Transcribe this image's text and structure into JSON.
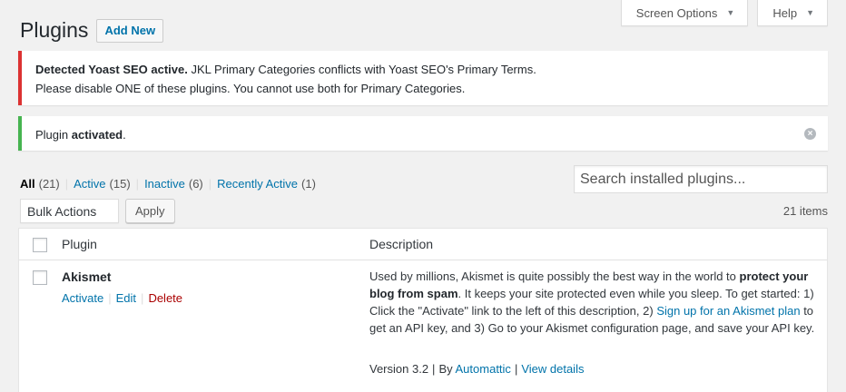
{
  "screen_meta": {
    "screen_options_label": "Screen Options",
    "help_label": "Help",
    "caret_glyph": "▼"
  },
  "header": {
    "title": "Plugins",
    "add_new_label": "Add New"
  },
  "notices": {
    "error": {
      "strong": "Detected Yoast SEO active.",
      "text1": " JKL Primary Categories conflicts with Yoast SEO's Primary Terms.",
      "text2": "Please disable ONE of these plugins. You cannot use both for Primary Categories.",
      "accent_color": "#dc3232"
    },
    "success": {
      "prefix": "Plugin ",
      "strong": "activated",
      "suffix": ".",
      "accent_color": "#46b450",
      "dismiss_glyph": "×"
    }
  },
  "filters": {
    "all": {
      "label": "All",
      "count": "(21)"
    },
    "active": {
      "label": "Active",
      "count": "(15)"
    },
    "inactive": {
      "label": "Inactive",
      "count": "(6)"
    },
    "recently_active": {
      "label": "Recently Active",
      "count": "(1)"
    },
    "separator": "|"
  },
  "search": {
    "placeholder": "Search installed plugins..."
  },
  "bulk": {
    "selected": "Bulk Actions",
    "apply_label": "Apply",
    "items_count": "21 items"
  },
  "table": {
    "headers": {
      "plugin": "Plugin",
      "description": "Description"
    },
    "rows": [
      {
        "name": "Akismet",
        "actions": {
          "activate": "Activate",
          "edit": "Edit",
          "delete": "Delete",
          "separator": "|"
        },
        "description": {
          "p1": "Used by millions, Akismet is quite possibly the best way in the world to ",
          "p1_strong": "protect your blog from spam",
          "p2": ". It keeps your site protected even while you sleep. To get started: 1) Click the \"Activate\" link to the left of this description, 2) ",
          "link": "Sign up for an Akismet plan",
          "p3": " to get an API key, and 3) Go to your Akismet configuration page, and save your API key."
        },
        "version": "Version 3.2",
        "by": "By",
        "author": "Automattic",
        "view_details": "View details",
        "separator": "|"
      }
    ]
  },
  "colors": {
    "link": "#0073aa",
    "delete": "#aa0000",
    "background": "#f1f1f1"
  }
}
